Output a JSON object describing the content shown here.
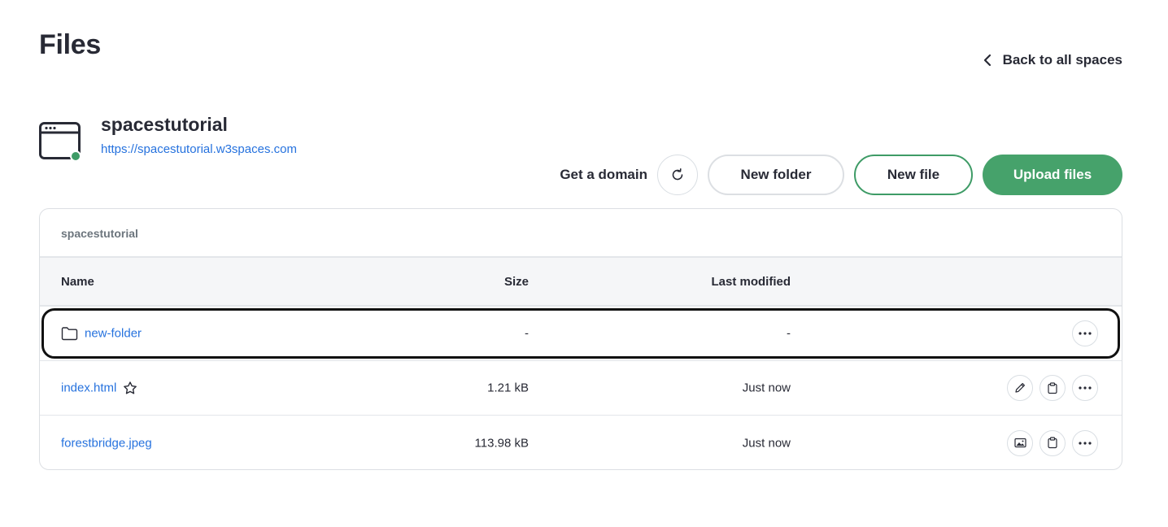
{
  "page": {
    "title": "Files",
    "back_label": "Back to all spaces"
  },
  "space": {
    "name": "spacestutorial",
    "url": "https://spacestutorial.w3spaces.com",
    "status_color": "#3e9b66"
  },
  "actions": {
    "get_domain": "Get a domain",
    "new_folder": "New folder",
    "new_file": "New file",
    "upload_files": "Upload files"
  },
  "table": {
    "path": "spacestutorial",
    "headers": {
      "name": "Name",
      "size": "Size",
      "modified": "Last modified"
    },
    "rows": [
      {
        "name": "new-folder",
        "size": "-",
        "modified": "-",
        "type": "folder",
        "icon": "folder-icon"
      },
      {
        "name": "index.html",
        "size": "1.21 kB",
        "modified": "Just now",
        "type": "html",
        "icon": "star-icon"
      },
      {
        "name": "forestbridge.jpeg",
        "size": "113.98 kB",
        "modified": "Just now",
        "type": "image"
      }
    ]
  },
  "colors": {
    "accent": "#46a26b",
    "link": "#2672de",
    "text": "#282a35"
  }
}
